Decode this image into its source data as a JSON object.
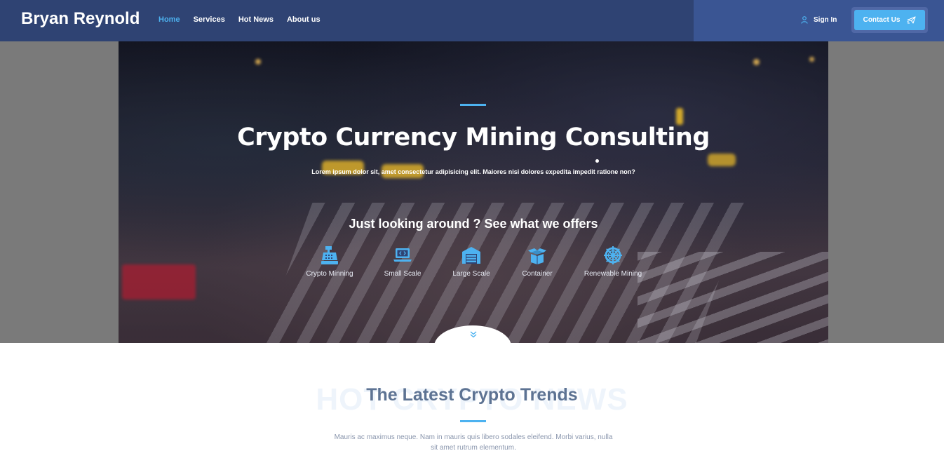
{
  "header": {
    "brand": "Bryan Reynold",
    "nav": [
      "Home",
      "Services",
      "Hot News",
      "About us"
    ],
    "active_nav": "Home",
    "sign_in_label": "Sign In",
    "contact_label": "Contact Us",
    "sign_in_icon": "user-icon",
    "contact_icon": "paper-plane-icon"
  },
  "hero": {
    "title": "Crypto Currency Mining Consulting",
    "subtitle": "Lorem ipsum dolor sit, amet consectetur adipisicing elit. Maiores nisi dolores expedita impedit ratione non?",
    "offer_heading": "Just looking around ? See what we offers",
    "services": [
      {
        "label": "Crypto Minning",
        "icon": "cash-register-icon"
      },
      {
        "label": "Small Scale",
        "icon": "laptop-code-icon"
      },
      {
        "label": "Large Scale",
        "icon": "warehouse-icon"
      },
      {
        "label": "Container",
        "icon": "box-open-icon"
      },
      {
        "label": "Renewable Mining",
        "icon": "dharmachakra-icon"
      }
    ],
    "scroll_icon": "chevron-double-down-icon"
  },
  "section": {
    "ghost_text": "HOT CRYPTO NEWS",
    "title": "The Latest Crypto Trends",
    "text": "Mauris ac maximus neque. Nam in mauris quis libero sodales eleifend. Morbi varius, nulla sit amet rutrum elementum."
  },
  "colors": {
    "navbar": "#2f4373",
    "navbar_right": "#3a5593",
    "accent": "#4db2f0",
    "section_title": "#5d7393"
  }
}
